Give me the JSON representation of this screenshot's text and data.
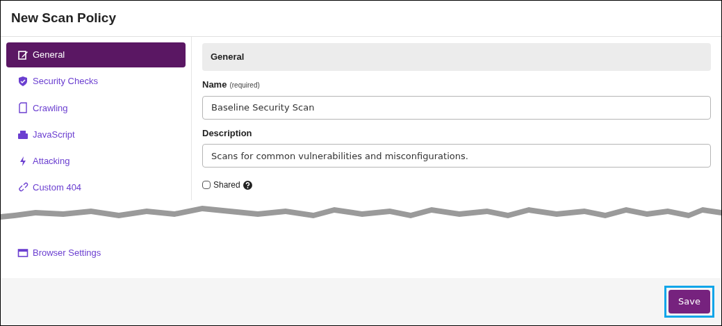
{
  "window": {
    "title": "New Scan Policy"
  },
  "sidebar": {
    "items": [
      {
        "kind": "edit",
        "label": "General",
        "selected": true
      },
      {
        "kind": "shield",
        "label": "Security Checks",
        "selected": false
      },
      {
        "kind": "page",
        "label": "Crawling",
        "selected": false
      },
      {
        "kind": "printer",
        "label": "JavaScript",
        "selected": false
      },
      {
        "kind": "bolt",
        "label": "Attacking",
        "selected": false
      },
      {
        "kind": "link",
        "label": "Custom 404",
        "selected": false
      }
    ],
    "items_after_break": [
      {
        "kind": "window",
        "label": "Browser Settings",
        "selected": false
      }
    ]
  },
  "section": {
    "title": "General"
  },
  "fields": [
    {
      "label": "Name",
      "note": "(required)",
      "value": "Baseline Security Scan"
    },
    {
      "label": "Description",
      "value": "Scans for common vulnerabilities and misconfigurations."
    }
  ],
  "shared": {
    "label": "Shared",
    "checked": false
  },
  "footer": {
    "save": "Save",
    "highlighted": true
  }
}
